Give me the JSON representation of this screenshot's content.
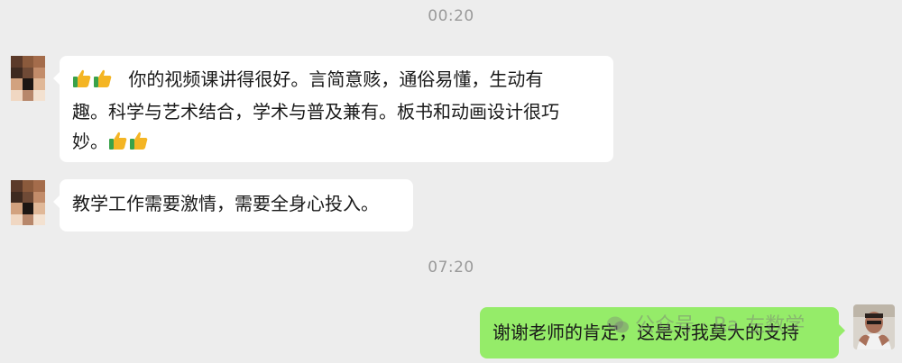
{
  "timestamps": [
    "00:20",
    "07:20"
  ],
  "messages": [
    {
      "side": "received",
      "lines": [
        "你的视频课讲得很好。言简意赅，通俗易懂，生动有",
        "趣。科学与艺术结合，学术与普及兼有。板书和动画设计很巧",
        "妙。"
      ],
      "emoji": "thumbs-up-icon"
    },
    {
      "side": "received",
      "text": "教学工作需要激情，需要全身心投入。"
    },
    {
      "side": "sent",
      "text": "谢谢老师的肯定，这是对我莫大的支持"
    }
  ],
  "watermark": {
    "text": "公众号 · Ra    左数学"
  },
  "colors": {
    "background": "#ededed",
    "received_bubble": "#ffffff",
    "sent_bubble": "#95ec69",
    "timestamp": "#9a9a9a"
  }
}
